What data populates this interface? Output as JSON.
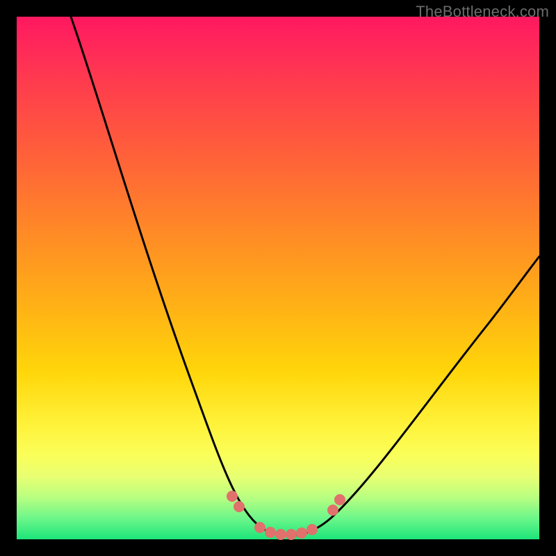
{
  "watermark": "TheBottleneck.com",
  "chart_data": {
    "type": "line",
    "title": "",
    "xlabel": "",
    "ylabel": "",
    "xlim": [
      0,
      100
    ],
    "ylim": [
      0,
      100
    ],
    "series": [
      {
        "name": "bottleneck-curve",
        "x": [
          10,
          15,
          20,
          25,
          30,
          35,
          40,
          45,
          48,
          50,
          52,
          55,
          58,
          60,
          65,
          70,
          75,
          80,
          85,
          90,
          95,
          100
        ],
        "values": [
          100,
          88,
          76,
          64,
          52,
          40,
          28,
          15,
          6,
          2,
          1,
          1,
          3,
          6,
          14,
          22,
          30,
          37,
          43,
          48,
          53,
          57
        ]
      }
    ],
    "markers": {
      "name": "bottom-dots",
      "color": "#e0716c",
      "points_x": [
        42,
        43,
        47,
        49,
        51,
        53,
        55,
        57,
        60,
        61
      ],
      "points_y": [
        8,
        6,
        2,
        1,
        1,
        1,
        1,
        2,
        6,
        8
      ]
    },
    "background_gradient": {
      "stops": [
        {
          "pos": 0,
          "color": "#ff1860"
        },
        {
          "pos": 18,
          "color": "#ff4a45"
        },
        {
          "pos": 42,
          "color": "#ff8c25"
        },
        {
          "pos": 68,
          "color": "#ffd60a"
        },
        {
          "pos": 84,
          "color": "#faff5a"
        },
        {
          "pos": 96,
          "color": "#6cf68a"
        },
        {
          "pos": 100,
          "color": "#1ce57a"
        }
      ]
    }
  }
}
